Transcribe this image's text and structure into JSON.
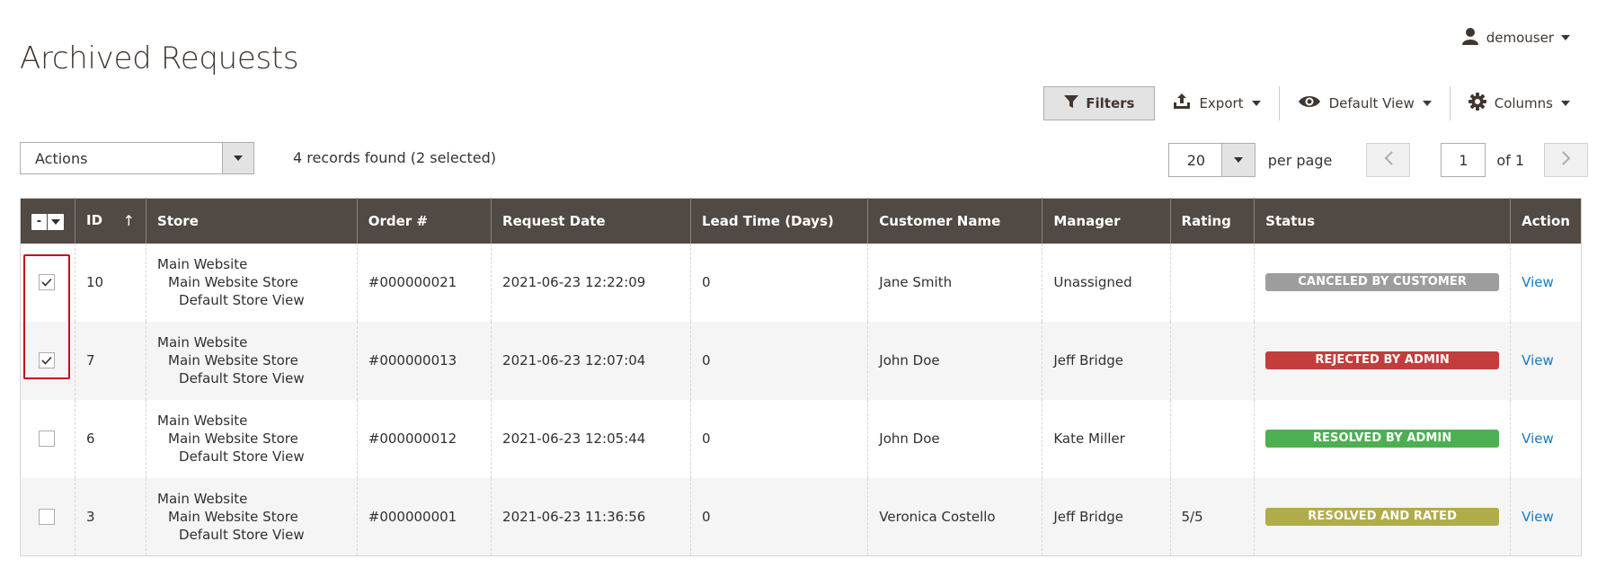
{
  "page": {
    "title": "Archived Requests"
  },
  "user": {
    "name": "demouser"
  },
  "toolbar": {
    "filters_label": "Filters",
    "export_label": "Export",
    "view_label": "Default View",
    "columns_label": "Columns"
  },
  "actions": {
    "label": "Actions"
  },
  "records": {
    "summary": "4 records found (2 selected)"
  },
  "pager": {
    "per_page_value": "20",
    "per_page_label": "per page",
    "current_page": "1",
    "of_label": "of 1"
  },
  "table": {
    "mass_select_label": "-",
    "columns": {
      "id": "ID",
      "store": "Store",
      "order": "Order #",
      "request_date": "Request Date",
      "lead_time": "Lead Time (Days)",
      "customer": "Customer Name",
      "manager": "Manager",
      "rating": "Rating",
      "status": "Status",
      "action": "Action"
    },
    "sort_arrow": "↑",
    "rows": [
      {
        "checked": true,
        "id": "10",
        "store": [
          "Main Website",
          "Main Website Store",
          "Default Store View"
        ],
        "order": "#000000021",
        "request_date": "2021-06-23 12:22:09",
        "lead_time": "0",
        "customer": "Jane Smith",
        "manager": "Unassigned",
        "rating": "",
        "status": "CANCELED BY CUSTOMER",
        "status_color": "#9d9d9d",
        "action": "View"
      },
      {
        "checked": true,
        "id": "7",
        "store": [
          "Main Website",
          "Main Website Store",
          "Default Store View"
        ],
        "order": "#000000013",
        "request_date": "2021-06-23 12:07:04",
        "lead_time": "0",
        "customer": "John Doe",
        "manager": "Jeff Bridge",
        "rating": "",
        "status": "REJECTED BY ADMIN",
        "status_color": "#c33d3d",
        "action": "View"
      },
      {
        "checked": false,
        "id": "6",
        "store": [
          "Main Website",
          "Main Website Store",
          "Default Store View"
        ],
        "order": "#000000012",
        "request_date": "2021-06-23 12:05:44",
        "lead_time": "0",
        "customer": "John Doe",
        "manager": "Kate Miller",
        "rating": "",
        "status": "RESOLVED BY ADMIN",
        "status_color": "#4cb050",
        "action": "View"
      },
      {
        "checked": false,
        "id": "3",
        "store": [
          "Main Website",
          "Main Website Store",
          "Default Store View"
        ],
        "order": "#000000001",
        "request_date": "2021-06-23 11:36:56",
        "lead_time": "0",
        "customer": "Veronica Costello",
        "manager": "Jeff Bridge",
        "rating": "5/5",
        "status": "RESOLVED AND RATED",
        "status_color": "#b0ac4a",
        "action": "View"
      }
    ]
  },
  "icons": {
    "user": "user-icon",
    "filter": "filter-icon",
    "export": "export-icon",
    "view": "eye-icon",
    "columns": "gear-icon"
  }
}
